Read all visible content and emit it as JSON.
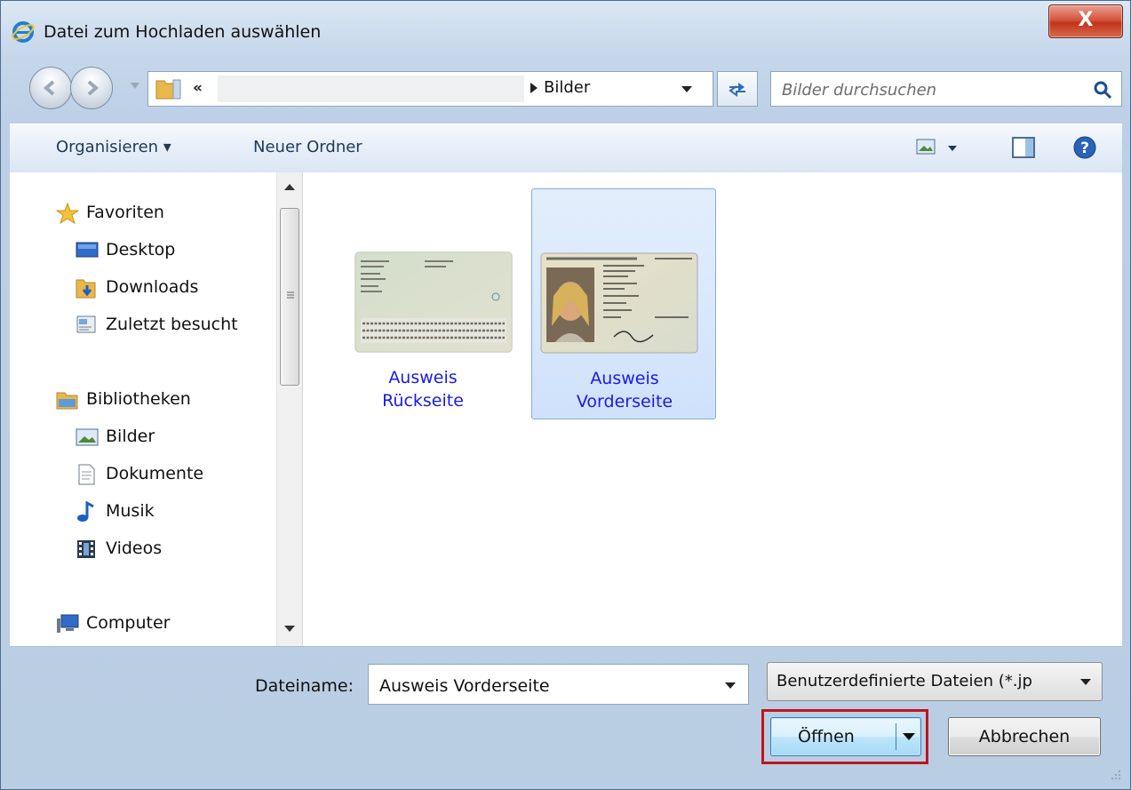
{
  "window": {
    "title": "Datei zum Hochladen auswählen",
    "close_label": "X"
  },
  "address": {
    "chevrons": "«",
    "crumb": "Bilder"
  },
  "search": {
    "placeholder": "Bilder durchsuchen"
  },
  "toolbar": {
    "organize_label": "Organisieren ▾",
    "new_folder_label": "Neuer Ordner"
  },
  "sidebar": {
    "favorites": {
      "label": "Favoriten",
      "icon": "star-icon"
    },
    "favorites_items": [
      {
        "label": "Desktop",
        "icon": "desktop-icon"
      },
      {
        "label": "Downloads",
        "icon": "downloads-folder-icon"
      },
      {
        "label": "Zuletzt besucht",
        "icon": "recent-places-icon"
      }
    ],
    "libraries": {
      "label": "Bibliotheken",
      "icon": "library-icon"
    },
    "library_items": [
      {
        "label": "Bilder",
        "icon": "pictures-icon"
      },
      {
        "label": "Dokumente",
        "icon": "documents-icon"
      },
      {
        "label": "Musik",
        "icon": "music-icon"
      },
      {
        "label": "Videos",
        "icon": "videos-icon"
      }
    ],
    "computer": {
      "label": "Computer",
      "icon": "computer-icon"
    }
  },
  "files": [
    {
      "line1": "Ausweis",
      "line2": "Rückseite",
      "selected": false
    },
    {
      "line1": "Ausweis",
      "line2": "Vorderseite",
      "selected": true
    }
  ],
  "footer": {
    "filename_label": "Dateiname:",
    "filename_value": "Ausweis Vorderseite",
    "filetype_value": "Benutzerdefinierte Dateien (*.jp",
    "open_label": "Öffnen",
    "cancel_label": "Abbrechen"
  },
  "colors": {
    "highlight": "#c0141d",
    "link_text": "#1a1ae6",
    "selection": "#cfe2fb"
  }
}
